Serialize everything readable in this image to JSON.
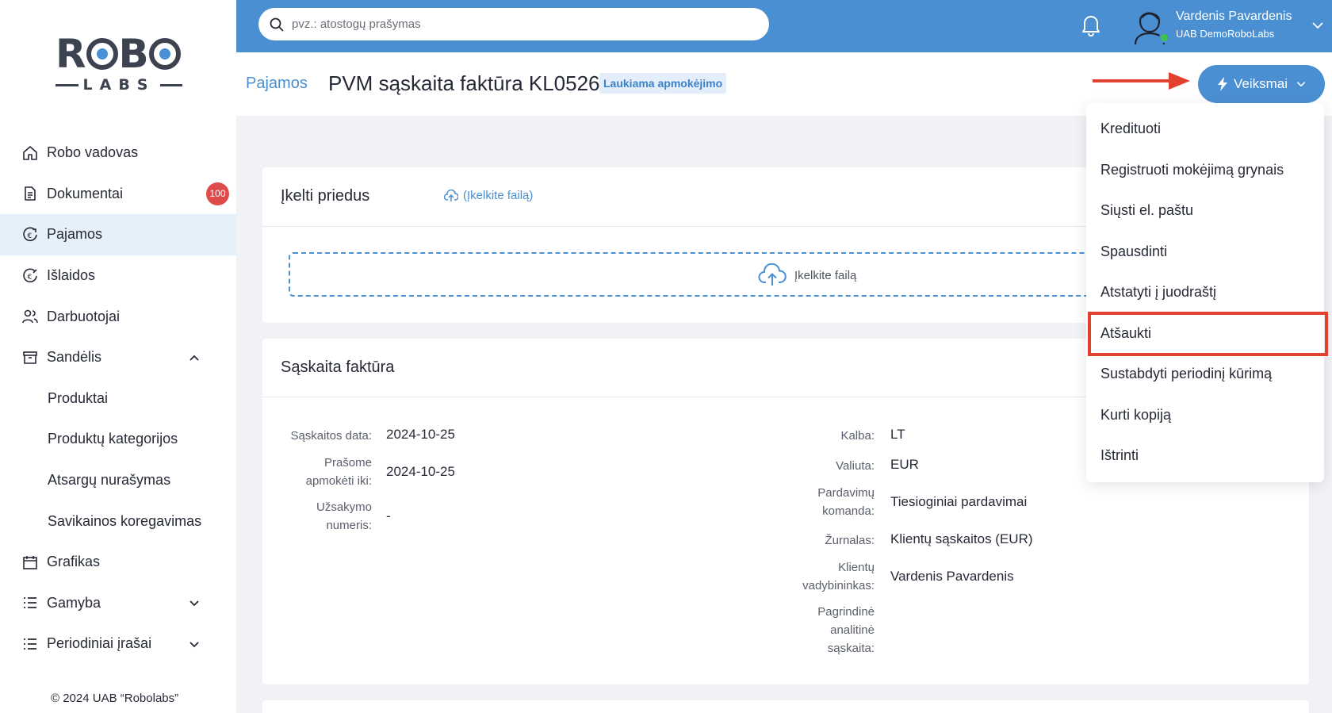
{
  "logo": {
    "top": "R B",
    "bottom": "LABS"
  },
  "sidebar": {
    "items": [
      {
        "label": "Robo vadovas"
      },
      {
        "label": "Dokumentai",
        "badge": "100"
      },
      {
        "label": "Pajamos"
      },
      {
        "label": "Išlaidos"
      },
      {
        "label": "Darbuotojai"
      },
      {
        "label": "Sandėlis"
      },
      {
        "label": "Produktai"
      },
      {
        "label": "Produktų kategorijos"
      },
      {
        "label": "Atsargų nurašymas"
      },
      {
        "label": "Savikainos koregavimas"
      },
      {
        "label": "Grafikas"
      },
      {
        "label": "Gamyba"
      },
      {
        "label": "Periodiniai įrašai"
      }
    ],
    "copyright": "© 2024 UAB “Robolabs”"
  },
  "topbar": {
    "search_placeholder": "pvz.: atostogų prašymas",
    "user_name": "Vardenis Pavardenis",
    "user_company": "UAB DemoRoboLabs"
  },
  "header": {
    "breadcrumb": "Pajamos",
    "title": "PVM sąskaita faktūra KL0526",
    "status": "Laukiama apmokėjimo",
    "actions_label": "Veiksmai"
  },
  "attachments": {
    "title": "Įkelti priedus",
    "upload_link": "(Įkelkite failą)",
    "dropzone_text": "Įkelkite failą"
  },
  "invoice": {
    "title": "Sąskaita faktūra",
    "left_fields": [
      {
        "label": "Sąskaitos data:",
        "value": "2024-10-25"
      },
      {
        "label_l1": "Prašome",
        "label_l2": "apmokėti iki:",
        "value": "2024-10-25"
      },
      {
        "label_l1": "Užsakymo",
        "label_l2": "numeris:",
        "value": "-"
      }
    ],
    "right_fields": [
      {
        "label": "Kalba:",
        "value": "LT"
      },
      {
        "label": "Valiuta:",
        "value": "EUR"
      },
      {
        "label_l1": "Pardavimų",
        "label_l2": "komanda:",
        "value": "Tiesioginiai pardavimai"
      },
      {
        "label": "Žurnalas:",
        "value": "Klientų sąskaitos (EUR)"
      },
      {
        "label_l1": "Klientų",
        "label_l2": "vadybininkas:",
        "value": "Vardenis Pavardenis"
      },
      {
        "label_l1": "Pagrindinė",
        "label_l2": "analitinė",
        "label_l3": "sąskaita:",
        "value": ""
      }
    ]
  },
  "actions_menu": [
    {
      "label": "Kredituoti"
    },
    {
      "label": "Registruoti mokėjimą grynais"
    },
    {
      "label": "Siųsti el. paštu"
    },
    {
      "label": "Spausdinti"
    },
    {
      "label": "Atstatyti į juodraštį"
    },
    {
      "label": "Atšaukti",
      "highlighted": true
    },
    {
      "label": "Sustabdyti periodinį kūrimą"
    },
    {
      "label": "Kurti kopiją"
    },
    {
      "label": "Ištrinti"
    }
  ],
  "colors": {
    "accent": "#4b8fd3",
    "badge": "#de4b4b",
    "highlight": "#e2412f",
    "online": "#3fc24a"
  }
}
